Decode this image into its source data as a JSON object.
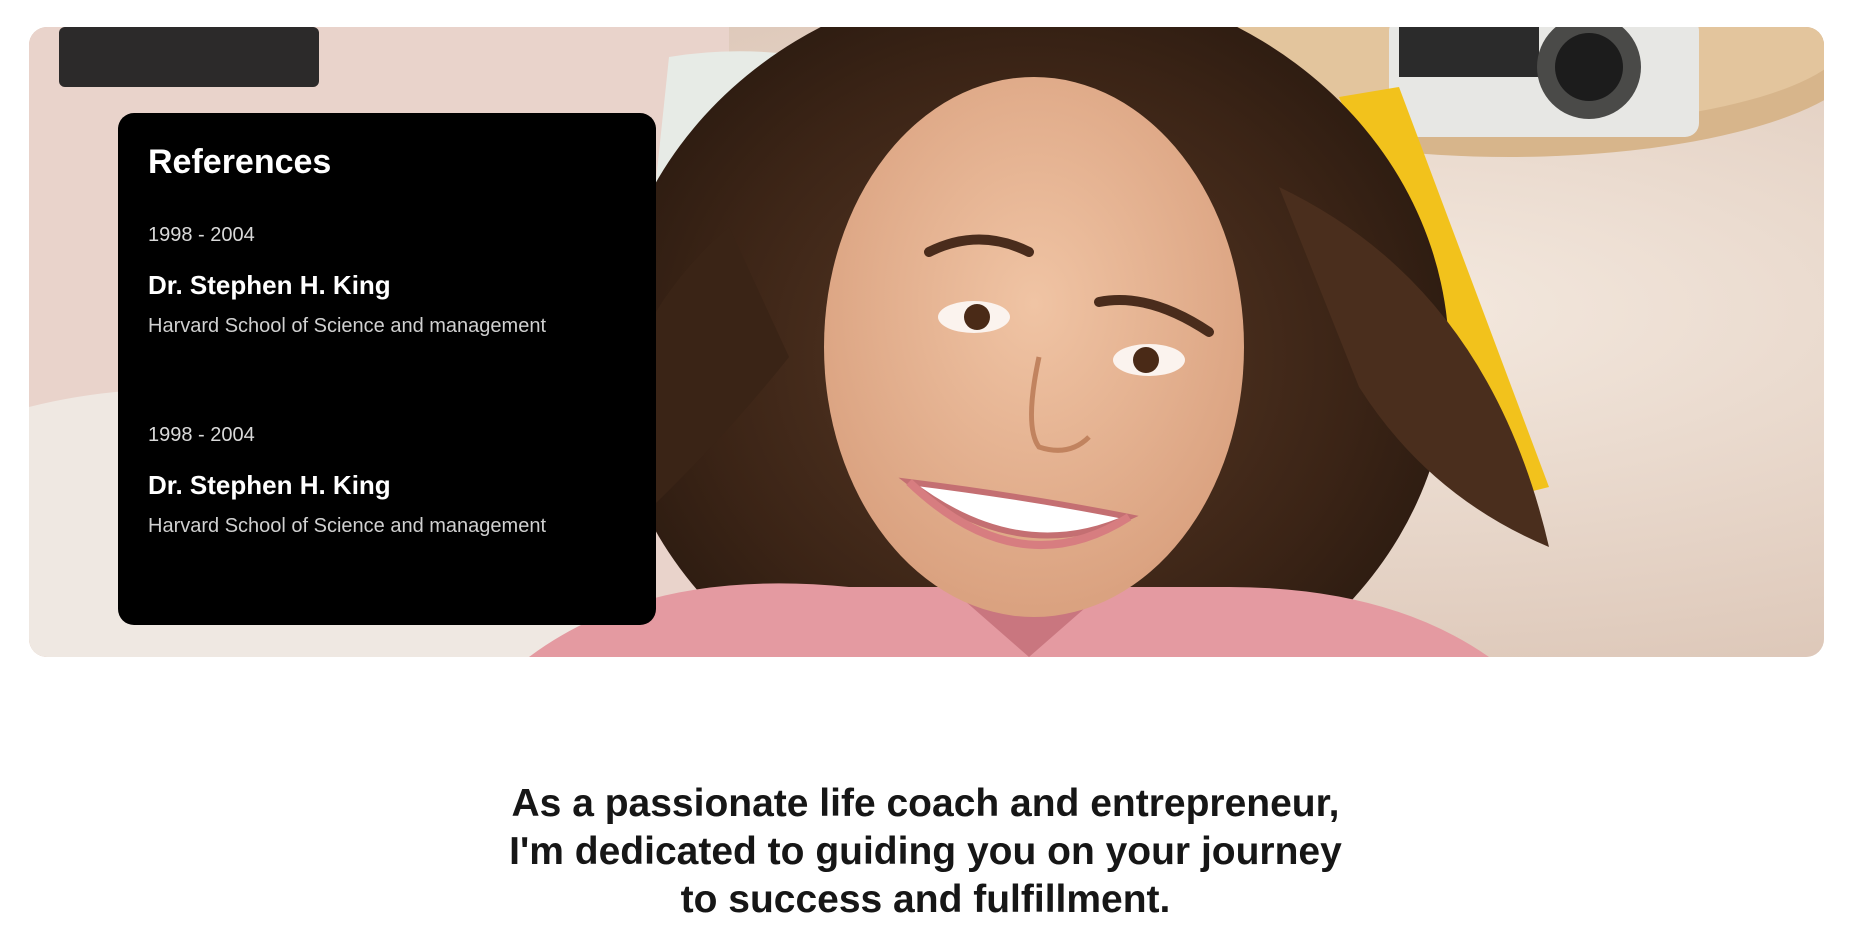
{
  "references": {
    "title": "References",
    "items": [
      {
        "years": "1998 - 2004",
        "name": "Dr. Stephen H. King",
        "school": "Harvard School of Science and management"
      },
      {
        "years": "1998 - 2004",
        "name": "Dr. Stephen H. King",
        "school": "Harvard School of Science and management"
      }
    ]
  },
  "tagline": {
    "lines": [
      "As a passionate life coach and entrepreneur,",
      "I'm dedicated to guiding you on your journey",
      "to success and fulfillment."
    ]
  },
  "colors": {
    "card_background": "#000000",
    "page_background": "#ffffff",
    "headline_text": "#161616"
  },
  "icons": {
    "hero_image": "smiling-woman-photo"
  }
}
